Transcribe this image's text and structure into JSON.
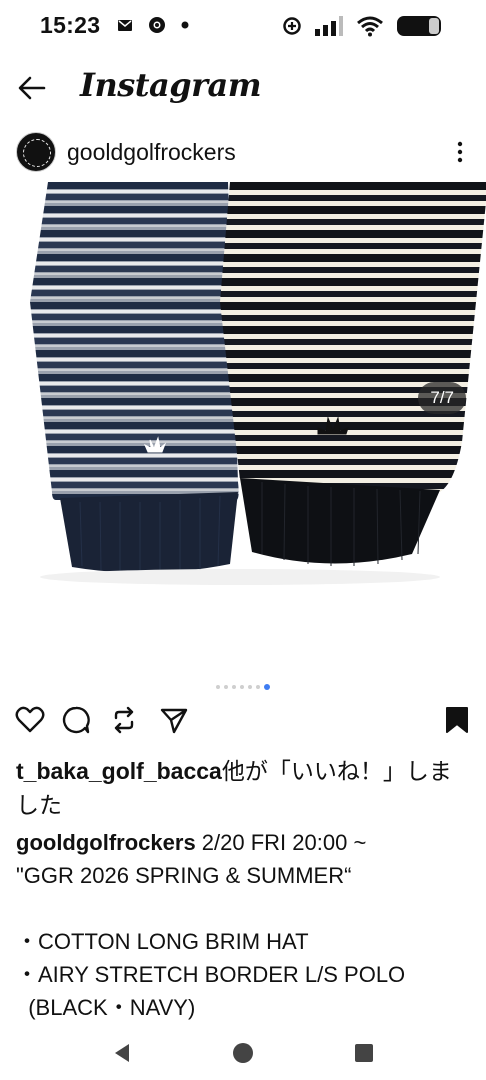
{
  "status_bar": {
    "time": "15:23",
    "left_icons": [
      "mail-icon",
      "chrome-icon",
      "dot-icon"
    ],
    "right_icons": [
      "data-saver-icon",
      "signal-icon",
      "wifi-icon",
      "battery-icon"
    ]
  },
  "header": {
    "back_icon": "back-arrow-icon",
    "title": "Instagram"
  },
  "post": {
    "username": "gooldgolfrockers",
    "carousel_counter": "7/7",
    "carousel_total": 7,
    "carousel_active": 7,
    "image_description_icon": "striped-sleeves-photo"
  },
  "actions": {
    "icons": [
      "heart-icon",
      "comment-icon",
      "repost-icon",
      "share-icon",
      "bookmark-icon"
    ]
  },
  "likes": {
    "user": "t_baka_golf_bacca",
    "suffix": "他が「いいね！」しました"
  },
  "caption": {
    "user": "gooldgolfrockers",
    "text": " 2/20 FRI 20:00 ~\n\"GGR 2026 SPRING & SUMMER“\n\n・COTTON LONG BRIM HAT\n・AIRY STRETCH BORDER L/S POLO\n  (BLACK・NAVY)"
  },
  "nav": {
    "icons": [
      "back-triangle-icon",
      "home-circle-icon",
      "recents-square-icon"
    ]
  },
  "colors": {
    "accent_dot": "#3f7df2",
    "navy": "#1b2a45",
    "black": "#111111"
  }
}
